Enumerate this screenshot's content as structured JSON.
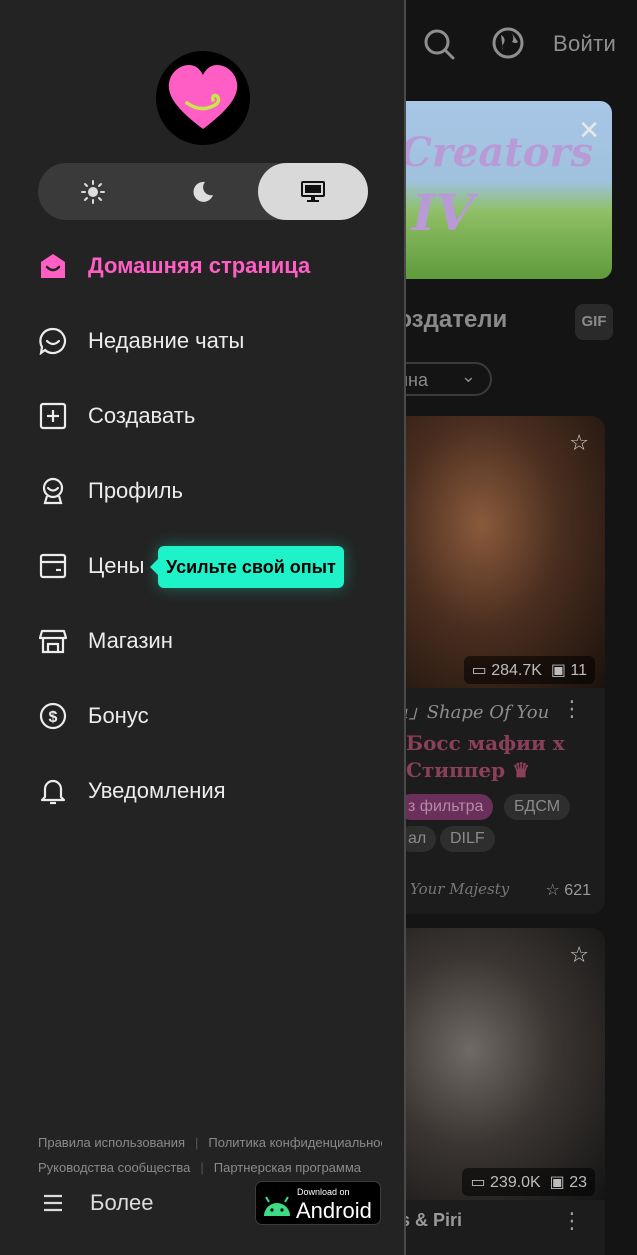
{
  "header": {
    "login_label": "Войти"
  },
  "background": {
    "banner": {
      "line1": "Creators",
      "line2": "IV",
      "close_glyph": "✕"
    },
    "section_title": "Создатели",
    "gif_label": "GIF",
    "filter_label": "ина",
    "cards": [
      {
        "chats": "284.7K",
        "books": "11",
        "author": "a」Shape Of You",
        "title": "Босс мафии x Стиппер ♛",
        "tags": [
          "з фильтра",
          "БДСМ",
          "ал",
          "DILF"
        ],
        "footer": "Your Majesty",
        "likes": "621"
      },
      {
        "chats": "239.0K",
        "books": "23",
        "title": "s & Piri"
      }
    ]
  },
  "drawer": {
    "theme_options": [
      "light",
      "dark",
      "system"
    ],
    "theme_selected": "system",
    "nav": [
      {
        "label": "Домашняя страница",
        "icon": "home-icon",
        "active": true
      },
      {
        "label": "Недавние чаты",
        "icon": "chat-bubble-icon",
        "active": false
      },
      {
        "label": "Создавать",
        "icon": "plus-square-icon",
        "active": false
      },
      {
        "label": "Профиль",
        "icon": "profile-badge-icon",
        "active": false
      },
      {
        "label": "Цены",
        "icon": "pricing-card-icon",
        "active": false
      },
      {
        "label": "Магазин",
        "icon": "store-icon",
        "active": false
      },
      {
        "label": "Бонус",
        "icon": "dollar-coin-icon",
        "active": false
      },
      {
        "label": "Уведомления",
        "icon": "bell-icon",
        "active": false
      }
    ],
    "tooltip": "Усильте свой опыт",
    "footer_links": {
      "terms": "Правила использования",
      "privacy": "Политика конфиденциальности",
      "community": "Руководства сообщества",
      "affiliate": "Партнерская программа"
    },
    "more_label": "Более",
    "android_badge": {
      "small": "Download on",
      "big": "Android"
    },
    "colors": {
      "accent": "#ff5ec4",
      "tooltip_bg": "#1ef2c8",
      "drawer_bg": "#232323"
    }
  }
}
